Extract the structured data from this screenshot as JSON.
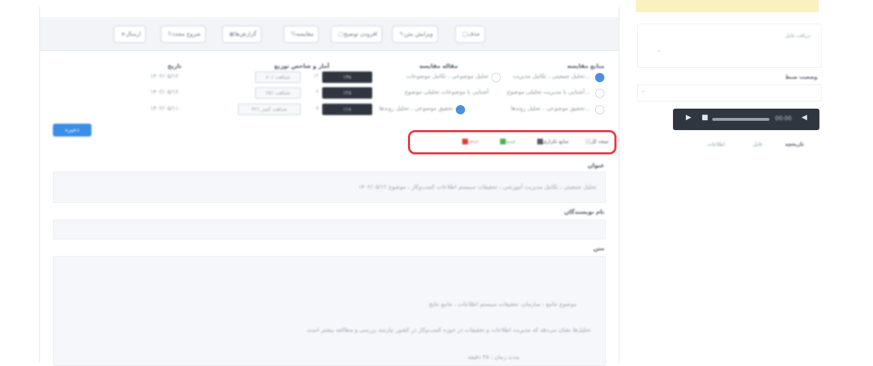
{
  "toolbar": {
    "buttons": [
      {
        "label": "حذف",
        "icon": "trash-icon"
      },
      {
        "label": "ویرایش متن",
        "icon": "edit-icon"
      },
      {
        "label": "افزودن توضیح",
        "icon": "comment-icon"
      },
      {
        "label": "مقایسه",
        "icon": "percent-icon"
      },
      {
        "label": "گزارش‌ها",
        "icon": "report-icon"
      },
      {
        "label": "شروع مجدد",
        "icon": "refresh-icon"
      },
      {
        "label": "ارسال",
        "icon": "send-icon"
      }
    ]
  },
  "table": {
    "headers": {
      "source": "منابع مقایسه",
      "target": "مقاله مقایسه",
      "stats": "آمار و شاخص توزیع",
      "date": "تاریخ"
    },
    "rows": [
      {
        "source": "تحلیل جمعیتی ، تکامل مدیریت...",
        "target": "تحلیل موضوعی ، تکامل موضوعات",
        "tag": "٪۳۵",
        "count": "۱۲",
        "light": "۸۰٪ شباهت",
        "date": "۱۴۰۲/۰۵/۱۲"
      },
      {
        "source": "آشنایی با مدیریت تحلیلی موضوع...",
        "target": "آشنایی با موضوعات تحلیلی موضوع",
        "tag": "٪۲۵",
        "count": "۸",
        "light": "۶۵٪ شباهت",
        "date": "۱۴۰۲/۰۵/۱۲"
      },
      {
        "source": "تحقیق موضوعی ، تحلیل روندها...",
        "target": "تحقیق موضوعی ، تحلیل روندها",
        "tag": "٪۱۸",
        "count": "۵",
        "light": "۴۲٪ شباهت کمتر",
        "date": "۱۴۰۲/۰۵/۱۱"
      }
    ],
    "submit_label": "ذخیره"
  },
  "legend": {
    "items": [
      {
        "label": "نتیجه کل",
        "color": "#e5e7eb"
      },
      {
        "label": "منابع تکراری",
        "color": "#555b63"
      },
      {
        "label": "جدید",
        "color": "#4caf50"
      },
      {
        "label": "حذف",
        "color": "#e53935"
      }
    ]
  },
  "fields": {
    "title_label": "عنوان",
    "title_value": "تحلیل جمعیتی ، تکامل مدیریت آموزشی ، تحقیقات سیستم اطلاعات کسب‌وکار ، موضوع ۱۴۰۲/۰۵/۱۲",
    "authors_label": "نام نویسندگان",
    "body_label": "متن",
    "body_lines": [
      "موضوع جامع : سازمان، تحقیقات سیستم اطلاعات ، جامع نتایج",
      "تحلیل‌ها نشان می‌دهد که مدیریت اطلاعات و تحقیقات در حوزه کسب‌وکار در کشور نیازمند بررسی و مطالعه بیشتر است",
      "مدت زمان : ۳۵ دقیقه"
    ]
  },
  "sidebar": {
    "box_title": "دریافت فایل",
    "box_value": "-",
    "field2_label": "وضعیت ضبط",
    "field2_value": "-",
    "player_time": "00:00",
    "tabs": [
      "اطلاعات",
      "فایل",
      "تاریخچه"
    ]
  }
}
